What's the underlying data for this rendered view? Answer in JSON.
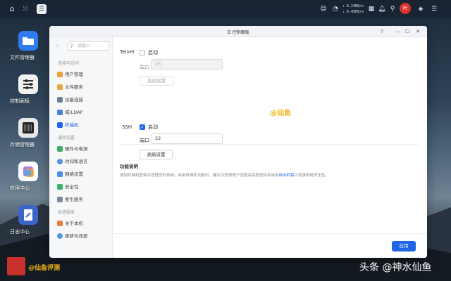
{
  "topbar": {
    "speed_up": "↑ 6.24KB/s",
    "speed_down": "↓ 6.45KB/s",
    "avatar_text": "叶"
  },
  "desktop": {
    "icons": [
      {
        "label": "文件管理器",
        "color": "#2f7bf0"
      },
      {
        "label": "控制面板",
        "color": "#f2f2f2"
      },
      {
        "label": "存储管理器",
        "color": "#e8e8e8"
      },
      {
        "label": "应用中心",
        "color": "#ffffff"
      },
      {
        "label": "日志中心",
        "color": "#3a66c8"
      }
    ]
  },
  "window": {
    "title": "控制面板",
    "help": "?",
    "minimize": "—",
    "maximize": "☐",
    "close": "✕"
  },
  "sidebar": {
    "search_placeholder": "请输入",
    "sections": [
      {
        "title": "连接与访问",
        "items": [
          "用户管理",
          "文件服务",
          "设备连接",
          "域/LDAP",
          "终端机"
        ]
      },
      {
        "title": "通用设置",
        "items": [
          "硬件与电源",
          "时间和语言",
          "网络设置",
          "安全性",
          "索引服务"
        ]
      },
      {
        "title": "系统服务",
        "items": [
          "关于本机",
          "更新与还原"
        ]
      }
    ],
    "active": "终端机"
  },
  "telnet": {
    "label": "Telnet",
    "enable_label": "启动",
    "port_label": "端口",
    "port_value": "23",
    "advanced_label": "高级设置"
  },
  "ssh": {
    "label": "SSH",
    "enable_label": "启动",
    "port_label": "端口",
    "port_value": "22",
    "advanced_label": "高级设置"
  },
  "watermark_center": "@仙鱼",
  "description": {
    "title": "功能说明",
    "text_before": "使用终端机登录并管理您的系统。启用终端机功能时，建议为登录账户设置高强度密码并启用",
    "link": "自动封锁",
    "text_after": "以增强系统安全性。"
  },
  "footer": {
    "apply_label": "应用"
  },
  "watermarks": {
    "bottom_left": "@仙鱼评测",
    "bottom_right": "头条 @神水仙鱼"
  },
  "colors": {
    "accent": "#1f66e5",
    "watermark": "#f2b51a"
  }
}
